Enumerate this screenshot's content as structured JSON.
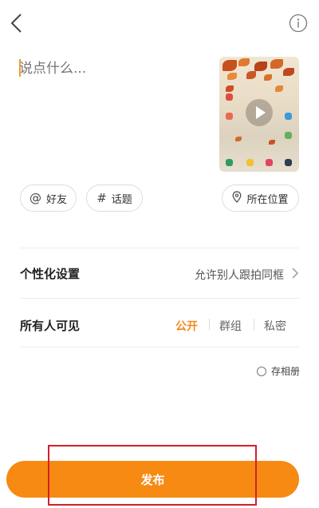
{
  "header": {
    "back_icon": "back-arrow-icon",
    "info_icon": "info-circle-icon"
  },
  "composer": {
    "placeholder": "说点什么..."
  },
  "video": {
    "thumbnail": "autumn-leaves-video-thumbnail",
    "play_icon": "play-icon"
  },
  "chips": {
    "friends_label": "好友",
    "topic_label": "话题",
    "location_label": "所在位置"
  },
  "settings": {
    "personalization_label": "个性化设置",
    "personalization_value": "允许别人跟拍同框",
    "visibility_label": "所有人可见",
    "visibility_options": [
      "公开",
      "群组",
      "私密"
    ],
    "visibility_selected": "公开"
  },
  "save_album_label": "存相册",
  "publish_label": "发布",
  "colors": {
    "accent": "#f68a12",
    "highlight": "#d3202a"
  }
}
